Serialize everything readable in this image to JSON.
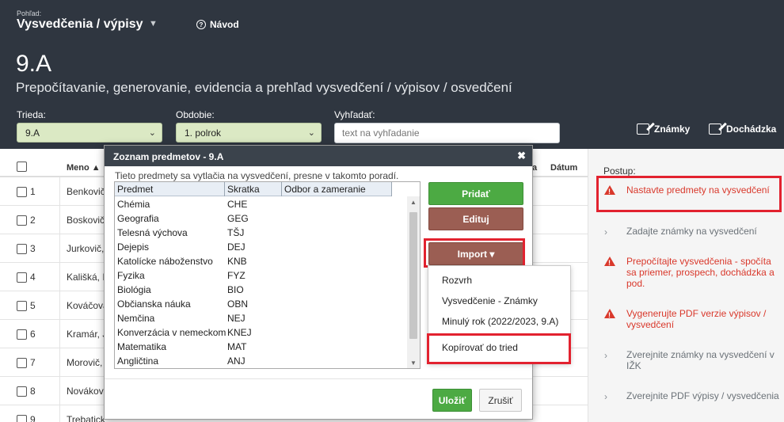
{
  "header": {
    "view_label": "Pohľad:",
    "view_title": "Vysvedčenia / výpisy",
    "help_label": "Návod",
    "class_title": "9.A",
    "subtitle": "Prepočítavanie, generovanie, evidencia a prehľad vysvedčení / výpisov / osvedčení",
    "filters": {
      "class_label": "Trieda:",
      "class_value": "9.A",
      "period_label": "Obdobie:",
      "period_value": "1. polrok",
      "search_label": "Vyhľadať:",
      "search_placeholder": "text na vyhľadanie"
    },
    "buttons": {
      "grades": "Známky",
      "attendance": "Dochádzka"
    }
  },
  "table": {
    "col_name": "Meno ▲",
    "col_a": "a",
    "col_date": "Dátum",
    "rows": [
      {
        "num": "1",
        "name": "Benkovič,"
      },
      {
        "num": "2",
        "name": "Boskovič,"
      },
      {
        "num": "3",
        "name": "Jurkovič,"
      },
      {
        "num": "4",
        "name": "Kališká, I"
      },
      {
        "num": "5",
        "name": "Kováčova"
      },
      {
        "num": "6",
        "name": "Kramár, J"
      },
      {
        "num": "7",
        "name": "Morovič,"
      },
      {
        "num": "8",
        "name": "Nováková"
      },
      {
        "num": "9",
        "name": "Trebatick"
      }
    ]
  },
  "side": {
    "title": "Postup:",
    "steps": [
      {
        "text": "Nastavte predmety na vysvedčení",
        "status": "warn"
      },
      {
        "text": "Zadajte známky na vysvedčení",
        "status": "todo"
      },
      {
        "text": "Prepočítajte vysvedčenia - spočíta sa priemer, prospech, dochádzka a pod.",
        "status": "warn"
      },
      {
        "text": "Vygenerujte PDF verzie výpisov / vysvedčení",
        "status": "warn"
      },
      {
        "text": "Zverejnite známky na vysvedčení v IŽK",
        "status": "todo"
      },
      {
        "text": "Zverejnite PDF výpisy / vysvedčenia",
        "status": "todo"
      }
    ]
  },
  "modal": {
    "title": "Zoznam predmetov - 9.A",
    "close": "✖",
    "description": "Tieto predmety sa vytlačia na vysvedčení, presne v takomto poradí.",
    "columns": [
      "Predmet",
      "Skratka",
      "Odbor a zameranie"
    ],
    "subjects": [
      {
        "name": "Chémia",
        "abbr": "CHE"
      },
      {
        "name": "Geografia",
        "abbr": "GEG"
      },
      {
        "name": "Telesná výchova",
        "abbr": "TŠJ"
      },
      {
        "name": "Dejepis",
        "abbr": "DEJ"
      },
      {
        "name": "Katolícke náboženstvo",
        "abbr": "KNB"
      },
      {
        "name": "Fyzika",
        "abbr": "FYZ"
      },
      {
        "name": "Biológia",
        "abbr": "BIO"
      },
      {
        "name": "Občianska náuka",
        "abbr": "OBN"
      },
      {
        "name": "Nemčina",
        "abbr": "NEJ"
      },
      {
        "name": "Konverzácia v nemeckom",
        "abbr": "KNEJ"
      },
      {
        "name": "Matematika",
        "abbr": "MAT"
      },
      {
        "name": "Angličtina",
        "abbr": "ANJ"
      }
    ],
    "buttons": {
      "add": "Pridať",
      "edit": "Edituj",
      "import": "Import ▾",
      "save": "Uložiť",
      "cancel": "Zrušiť"
    },
    "import_menu": [
      "Rozvrh",
      "Vysvedčenie - Známky",
      "Minulý rok (2022/2023, 9.A)",
      "Kopírovať do tried"
    ]
  },
  "colors": {
    "header_bg": "#2f3640",
    "accent_green": "#4caa43",
    "accent_brown": "#9b5e53",
    "warn_red": "#d9382b",
    "highlight_red": "#e2222f"
  }
}
